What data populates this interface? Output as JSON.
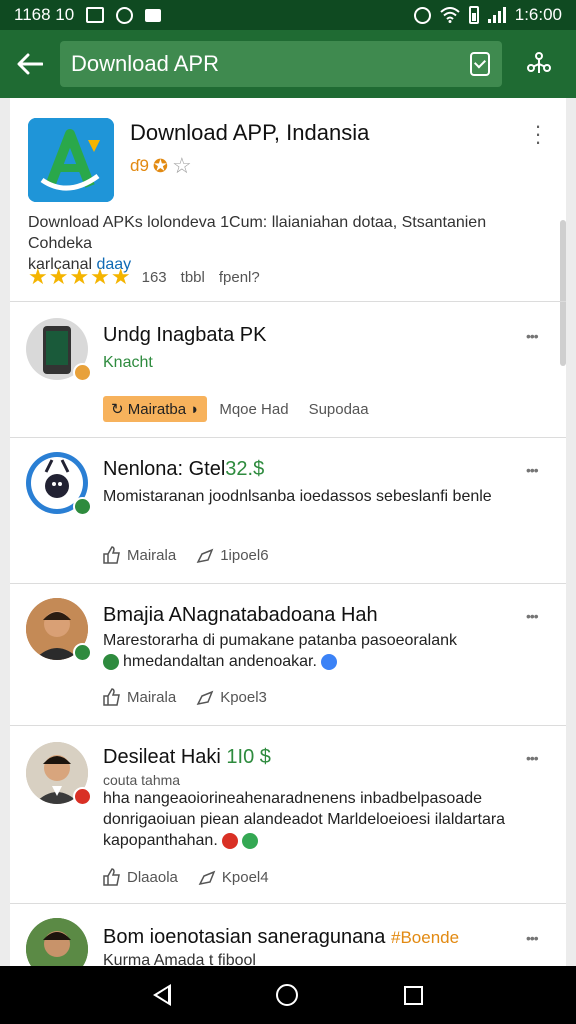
{
  "status_bar": {
    "time_left": "1168 10",
    "time_right": "1:6:00"
  },
  "toolbar": {
    "search_value": "Download APR"
  },
  "app": {
    "title": "Download APP, Indansia",
    "meta_text": "ɗ9",
    "description": "Download APKs lolondeva 1Cum: llaianiahan dotaa, Stsantanien Cohdeka",
    "description_line2_text": "karlcanal ",
    "description_link": "daay",
    "stars": "★★★★★",
    "rating_count": "163",
    "rating_text": "tbbl",
    "rating_extra": "fpenl?"
  },
  "reviews": [
    {
      "name": "Undg Inagbata PK",
      "sub": "Knacht",
      "chip": "Mairatba",
      "action1": "Mqoe Had",
      "action2": "Supodaa"
    },
    {
      "name": "Nenlona: Gtel",
      "tag": "32.$",
      "body": "Momistaranan joodnlsanba ioedassos sebeslanfi benle",
      "action1": "Mairala",
      "action2": "1ipoel6"
    },
    {
      "name": "Bmajia ANagnatabadoana Hah",
      "body_line1": "Marestorarha di pumakane patanba pasoeoralank",
      "body_line2": "hmedandaltan andenoakar.",
      "action1": "Mairala",
      "action2": "Kpoel3"
    },
    {
      "name": "Desileat Haki",
      "tag": "1I0 $",
      "sub": "couta tahma",
      "body": "hha nangeaoiorineahenaradnenens inbadbelpasoade donrigaoiuan piean alandeadot Marldeloeioesi ilaldartara kapopanthahan.",
      "action1": "Dlaaola",
      "action2": "Kpoel4"
    },
    {
      "name": "Bom ioenotasian saneragunana",
      "tag": "#Boende",
      "sub": "Kurma Amada t fibool"
    }
  ],
  "colors": {
    "toolbar": "#1f6b33",
    "status_bar": "#0f4a21",
    "search": "#3f8a4f",
    "chip": "#f7b25c",
    "accent_green": "#2e8b3e"
  }
}
